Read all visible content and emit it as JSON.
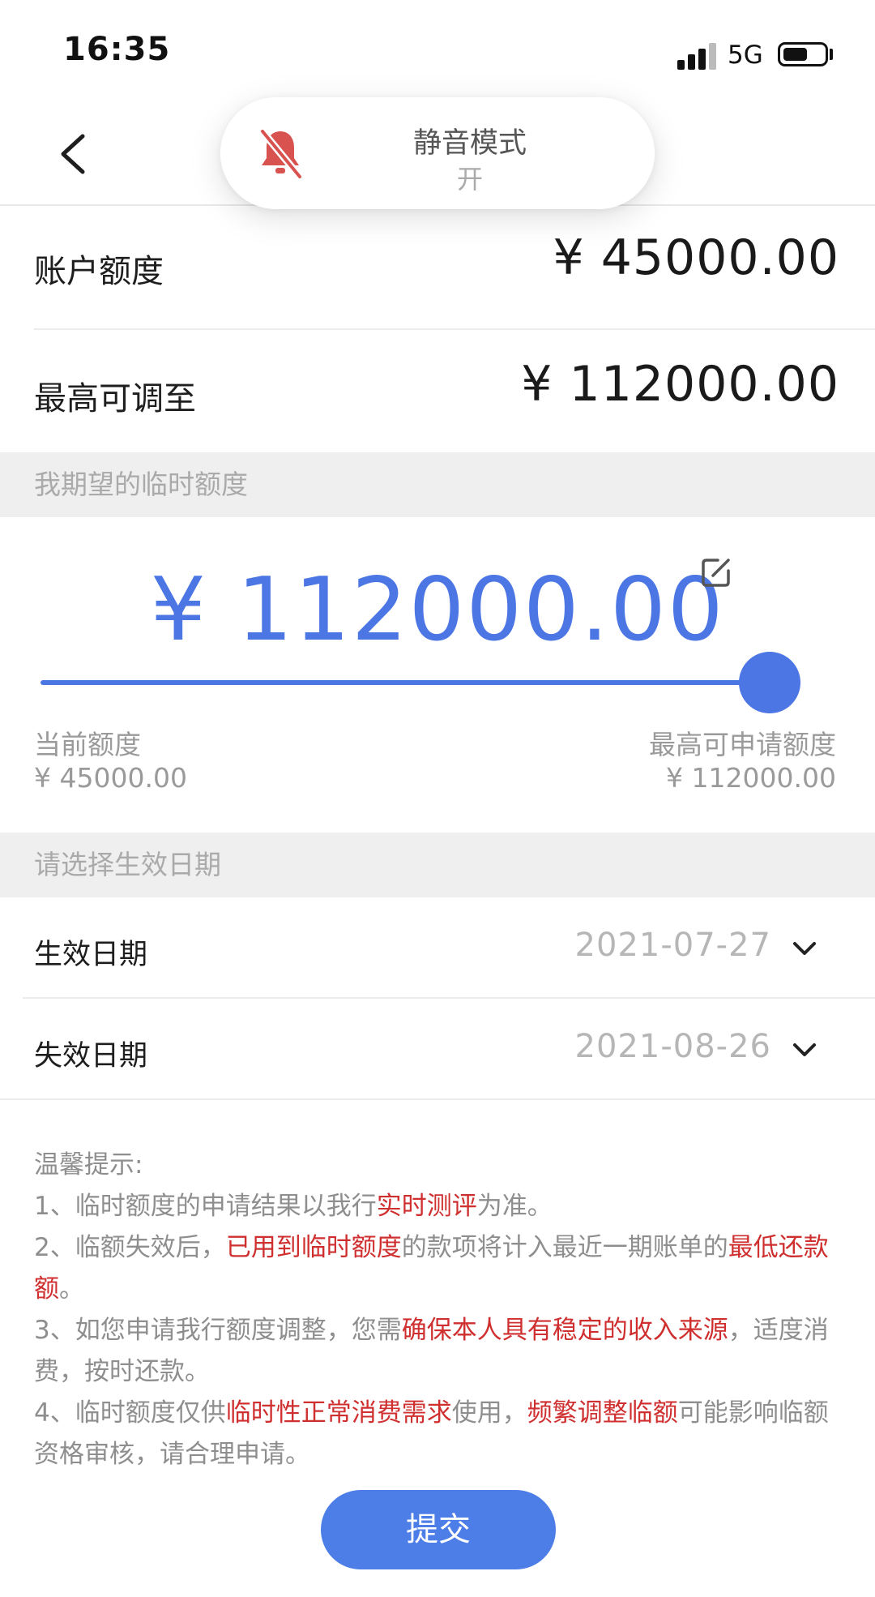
{
  "status_bar": {
    "time": "16:35",
    "network": "5G",
    "battery_level": 0.6
  },
  "toast": {
    "title": "静音模式",
    "subtitle": "开",
    "icon": "bell-slash-icon"
  },
  "limits": {
    "account_label": "账户额度",
    "account_value": "¥ 45000.00",
    "max_label": "最高可调至",
    "max_value": "¥ 112000.00"
  },
  "temp_section": {
    "header": "我期望的临时额度",
    "amount": "¥ 112000.00",
    "slider_fraction": 1.0,
    "current_label": "当前额度",
    "current_value": "¥ 45000.00",
    "max_label": "最高可申请额度",
    "max_value": "¥ 112000.00"
  },
  "date_section": {
    "header": "请选择生效日期",
    "effective_label": "生效日期",
    "effective_value": "2021-07-27",
    "expiry_label": "失效日期",
    "expiry_value": "2021-08-26"
  },
  "tips": {
    "title": "温馨提示:",
    "t1_a": "1、临时额度的申请结果以我行",
    "t1_b": "实时测评",
    "t1_c": "为准。",
    "t2_a": "2、临额失效后，",
    "t2_b": "已用到临时额度",
    "t2_c": "的款项将计入最近一期账单的",
    "t2_d": "最低还款额",
    "t2_e": "。",
    "t3_a": "3、如您申请我行额度调整，您需",
    "t3_b": "确保本人具有稳定的收入来源",
    "t3_c": "，适度消费，按时还款。",
    "t4_a": "4、临时额度仅供",
    "t4_b": "临时性正常消费需求",
    "t4_c": "使用，",
    "t4_d": "频繁调整临额",
    "t4_e": "可能影响临额资格审核，请合理申请。"
  },
  "submit_label": "提交",
  "colors": {
    "accent": "#4c76e4",
    "highlight": "#cf2f2f"
  }
}
